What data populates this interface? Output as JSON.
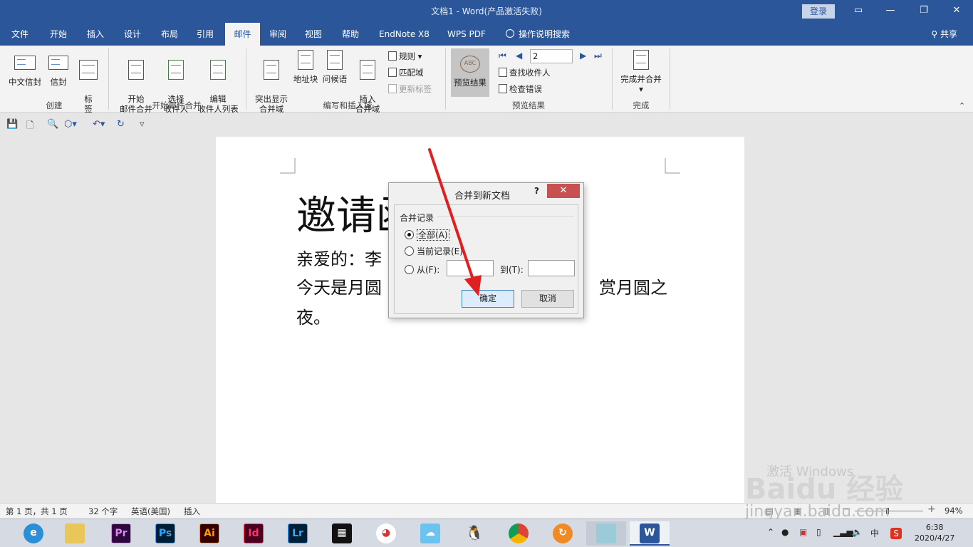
{
  "titlebar": {
    "title": "文档1  -  Word(产品激活失败)",
    "login": "登录"
  },
  "tabs": [
    "文件",
    "开始",
    "插入",
    "设计",
    "布局",
    "引用",
    "邮件",
    "审阅",
    "视图",
    "帮助",
    "EndNote X8",
    "WPS PDF",
    "操作说明搜索"
  ],
  "share": "共享",
  "ribbon": {
    "create": {
      "label": "创建",
      "chinese_envelope": "中文信封",
      "envelope": "信封",
      "labels": "标\n签"
    },
    "start_merge": {
      "label": "开始邮件合并",
      "start": "开始\n邮件合并",
      "select": "选择\n收件人",
      "edit": "编辑\n收件人列表"
    },
    "write_insert": {
      "label": "编写和插入域",
      "highlight": "突出显示\n合并域",
      "address": "地址块",
      "greeting": "问候语",
      "insert_field": "插入\n合并域",
      "rules": "规则",
      "match": "匹配域",
      "update": "更新标签"
    },
    "preview": {
      "label": "预览结果",
      "preview_results": "预览结果",
      "record": "2",
      "find_recipient": "查找收件人",
      "check_errors": "检查错误"
    },
    "finish": {
      "label": "完成",
      "finish_merge": "完成并合并"
    }
  },
  "document": {
    "title": "邀请函",
    "line1": "亲爱的：李",
    "line2a": "今天是月圆",
    "line2b": "赏月圆之",
    "line3": "夜。"
  },
  "dialog": {
    "title": "合并到新文档",
    "help": "?",
    "close": "✕",
    "group": "合并记录",
    "all": "全部(A)",
    "current": "当前记录(E)",
    "from": "从(F):",
    "to": "到(T):",
    "ok": "确定",
    "cancel": "取消"
  },
  "status": {
    "page": "第 1 页，共 1 页",
    "words": "32 个字",
    "language": "英语(美国)",
    "mode": "插入",
    "zoom": "94%"
  },
  "taskbar": {
    "apps": [
      "Pr",
      "Ps",
      "Ai",
      "Id",
      "Lr"
    ],
    "ime": "中",
    "time": "6:38",
    "date": "2020/4/27"
  },
  "watermark": {
    "activate": "激活 Windows",
    "brand": "Baidu 经验",
    "url": "jingyan.baidu.com"
  },
  "colors": {
    "word_blue": "#2b579a",
    "dialog_close": "#c75050",
    "arrow": "#e02020"
  }
}
